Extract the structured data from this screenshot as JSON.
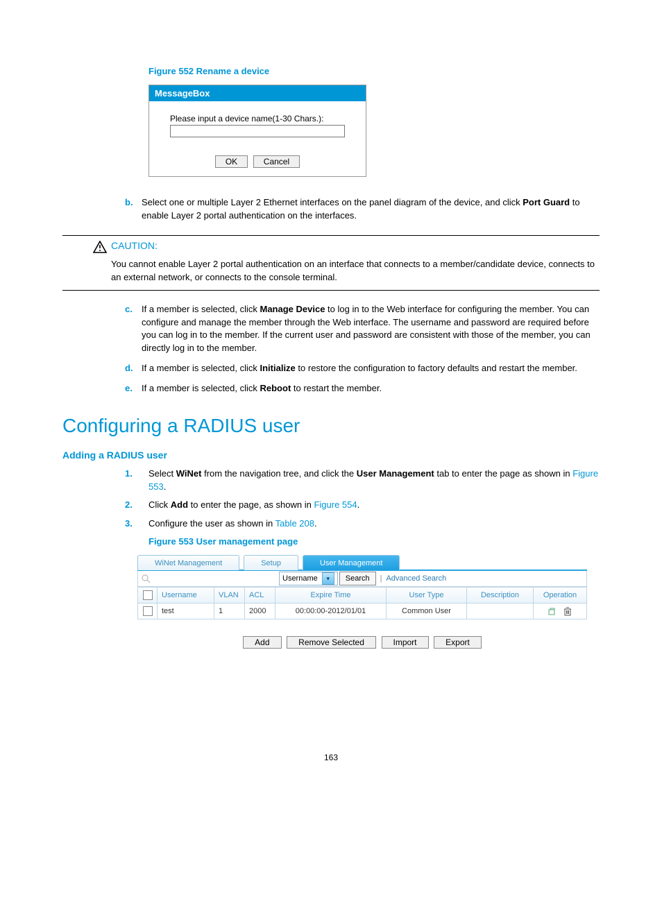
{
  "figure552": {
    "caption": "Figure 552 Rename a device",
    "title": "MessageBox",
    "prompt": "Please input a device name(1-30 Chars.):",
    "ok": "OK",
    "cancel": "Cancel"
  },
  "steps_b": {
    "marker": "b.",
    "text_before": "Select one or multiple Layer 2 Ethernet interfaces on the panel diagram of the device, and click ",
    "bold": "Port Guard",
    "text_after": " to enable Layer 2 portal authentication on the interfaces."
  },
  "caution": {
    "label": "CAUTION:",
    "body": "You cannot enable Layer 2 portal authentication on an interface that connects to a member/candidate device, connects to an external network, or connects to the console terminal."
  },
  "steps_c": {
    "marker": "c.",
    "t1": "If a member is selected, click ",
    "b1": "Manage Device",
    "t2": " to log in to the Web interface for configuring the member. You can configure and manage the member through the Web interface. The username and password are required before you can log in to the member. If the current user and password are consistent with those of the member, you can directly log in to the member."
  },
  "steps_d": {
    "marker": "d.",
    "t1": "If a member is selected, click ",
    "b1": "Initialize",
    "t2": " to restore the configuration to factory defaults and restart the member."
  },
  "steps_e": {
    "marker": "e.",
    "t1": "If a member is selected, click ",
    "b1": "Reboot",
    "t2": " to restart the member."
  },
  "h1": "Configuring a RADIUS user",
  "h2": "Adding a RADIUS user",
  "num1": {
    "marker": "1.",
    "t1": "Select ",
    "b1": "WiNet",
    "t2": " from the navigation tree, and click the ",
    "b2": "User Management",
    "t3": " tab to enter the page as shown in ",
    "link": "Figure 553",
    "t4": "."
  },
  "num2": {
    "marker": "2.",
    "t1": "Click ",
    "b1": "Add",
    "t2": " to enter the page, as shown in ",
    "link": "Figure 554",
    "t3": "."
  },
  "num3": {
    "marker": "3.",
    "t1": "Configure the user as shown in ",
    "link": "Table 208",
    "t2": "."
  },
  "figure553": {
    "caption": "Figure 553 User management page",
    "tab1": "WiNet Management",
    "tab2": "Setup",
    "tab3": "User Management",
    "search_field": "Username",
    "search_btn": "Search",
    "adv_search": "Advanced Search",
    "head": {
      "username": "Username",
      "vlan": "VLAN",
      "acl": "ACL",
      "expire": "Expire Time",
      "type": "User Type",
      "desc": "Description",
      "op": "Operation"
    },
    "row": {
      "username": "test",
      "vlan": "1",
      "acl": "2000",
      "expire": "00:00:00-2012/01/01",
      "type": "Common User",
      "desc": ""
    },
    "actions": {
      "add": "Add",
      "remove": "Remove Selected",
      "import": "Import",
      "export": "Export"
    }
  },
  "page_number": "163"
}
